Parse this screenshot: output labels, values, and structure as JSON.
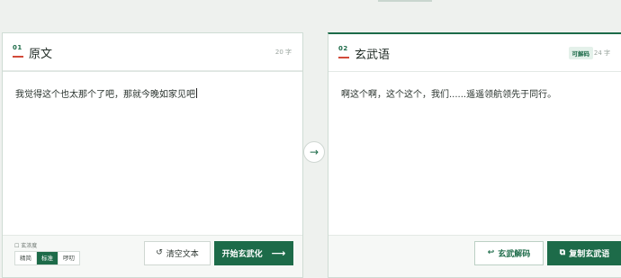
{
  "source": {
    "index": "01",
    "title": "原文",
    "count": "20 字",
    "text": "我觉得这个也太那个了吧，那就今晚如家见吧",
    "density_label": "☐ 玄浓度",
    "density_options": [
      "精简",
      "标准",
      "啰叨"
    ],
    "density_selected": "标准",
    "clear_label": "清空文本",
    "start_label": "开始玄武化"
  },
  "target": {
    "index": "02",
    "title": "玄武语",
    "badge": "可解码",
    "count": "24 字",
    "text": "啊这个啊，这个这个，我们......遥遥领航领先于同行。",
    "decode_label": "玄武解码",
    "copy_label": "复制玄武语"
  },
  "icons": {
    "clear": "refresh-icon",
    "start": "arrow-right-icon",
    "decode": "return-arrow-icon",
    "copy": "copy-icon",
    "divider": "arrow-right-icon"
  },
  "colors": {
    "accent": "#1d6b49",
    "index_underline": "#d24a3a"
  }
}
